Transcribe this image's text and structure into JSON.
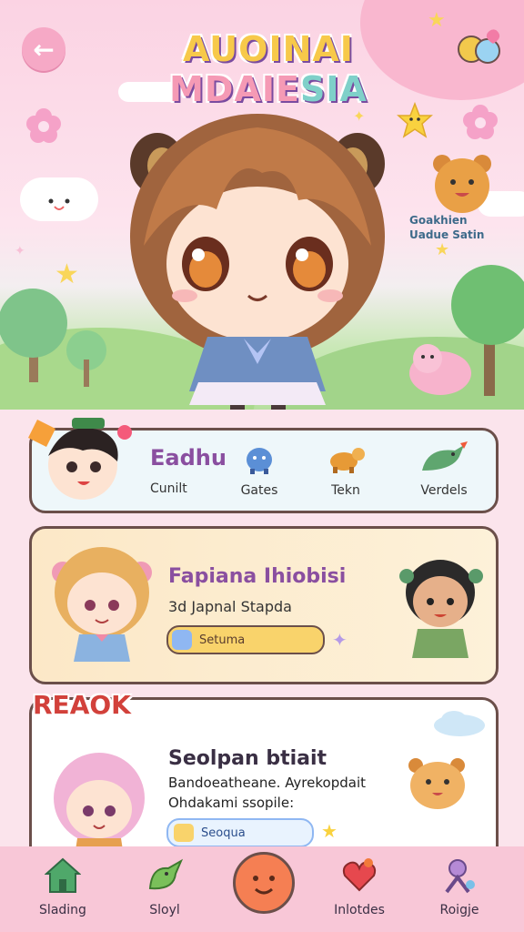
{
  "header": {
    "title_part1": "AUOINAI ",
    "title_part2": "MDAIE",
    "title_part3": "SIA",
    "back_icon": "arrow-left-icon",
    "menu_icon": "characters-icon"
  },
  "hero": {
    "sign_line1": "Goakhien",
    "sign_line2": "Uadue Satin"
  },
  "nav_card": {
    "name": "Eadhu",
    "subtitle": "Cunilt",
    "items": [
      {
        "label": "Gates",
        "icon": "blue-creature-icon"
      },
      {
        "label": "Tekn",
        "icon": "orange-turtle-icon"
      },
      {
        "label": "Verdels",
        "icon": "green-bird-icon"
      }
    ]
  },
  "profile_card": {
    "name": "Fapiana Ihiobisi",
    "subtitle": "3d Japnal Stapda",
    "pill_label": "Setuma"
  },
  "story_card": {
    "badge": "REAOK",
    "title": "Seolpan btiait",
    "line1": "Bandoeatheane. Ayrekopdait",
    "line2": "Ohdakami ssopile:",
    "pill_label": "Seoqua"
  },
  "tabbar": {
    "tabs": [
      {
        "label": "Slading",
        "icon": "house-icon"
      },
      {
        "label": "Sloyl",
        "icon": "bird-icon"
      },
      {
        "label": "",
        "icon": "smiley-face-icon"
      },
      {
        "label": "Inlotdes",
        "icon": "heart-icon"
      },
      {
        "label": "Roigje",
        "icon": "person-icon"
      }
    ]
  },
  "colors": {
    "accent_pink": "#f6a9c6",
    "card_border": "#6b4f4a",
    "name_purple": "#8a4fa0",
    "tabbar_bg": "#f8c7d7",
    "center_orange": "#f57f53"
  }
}
